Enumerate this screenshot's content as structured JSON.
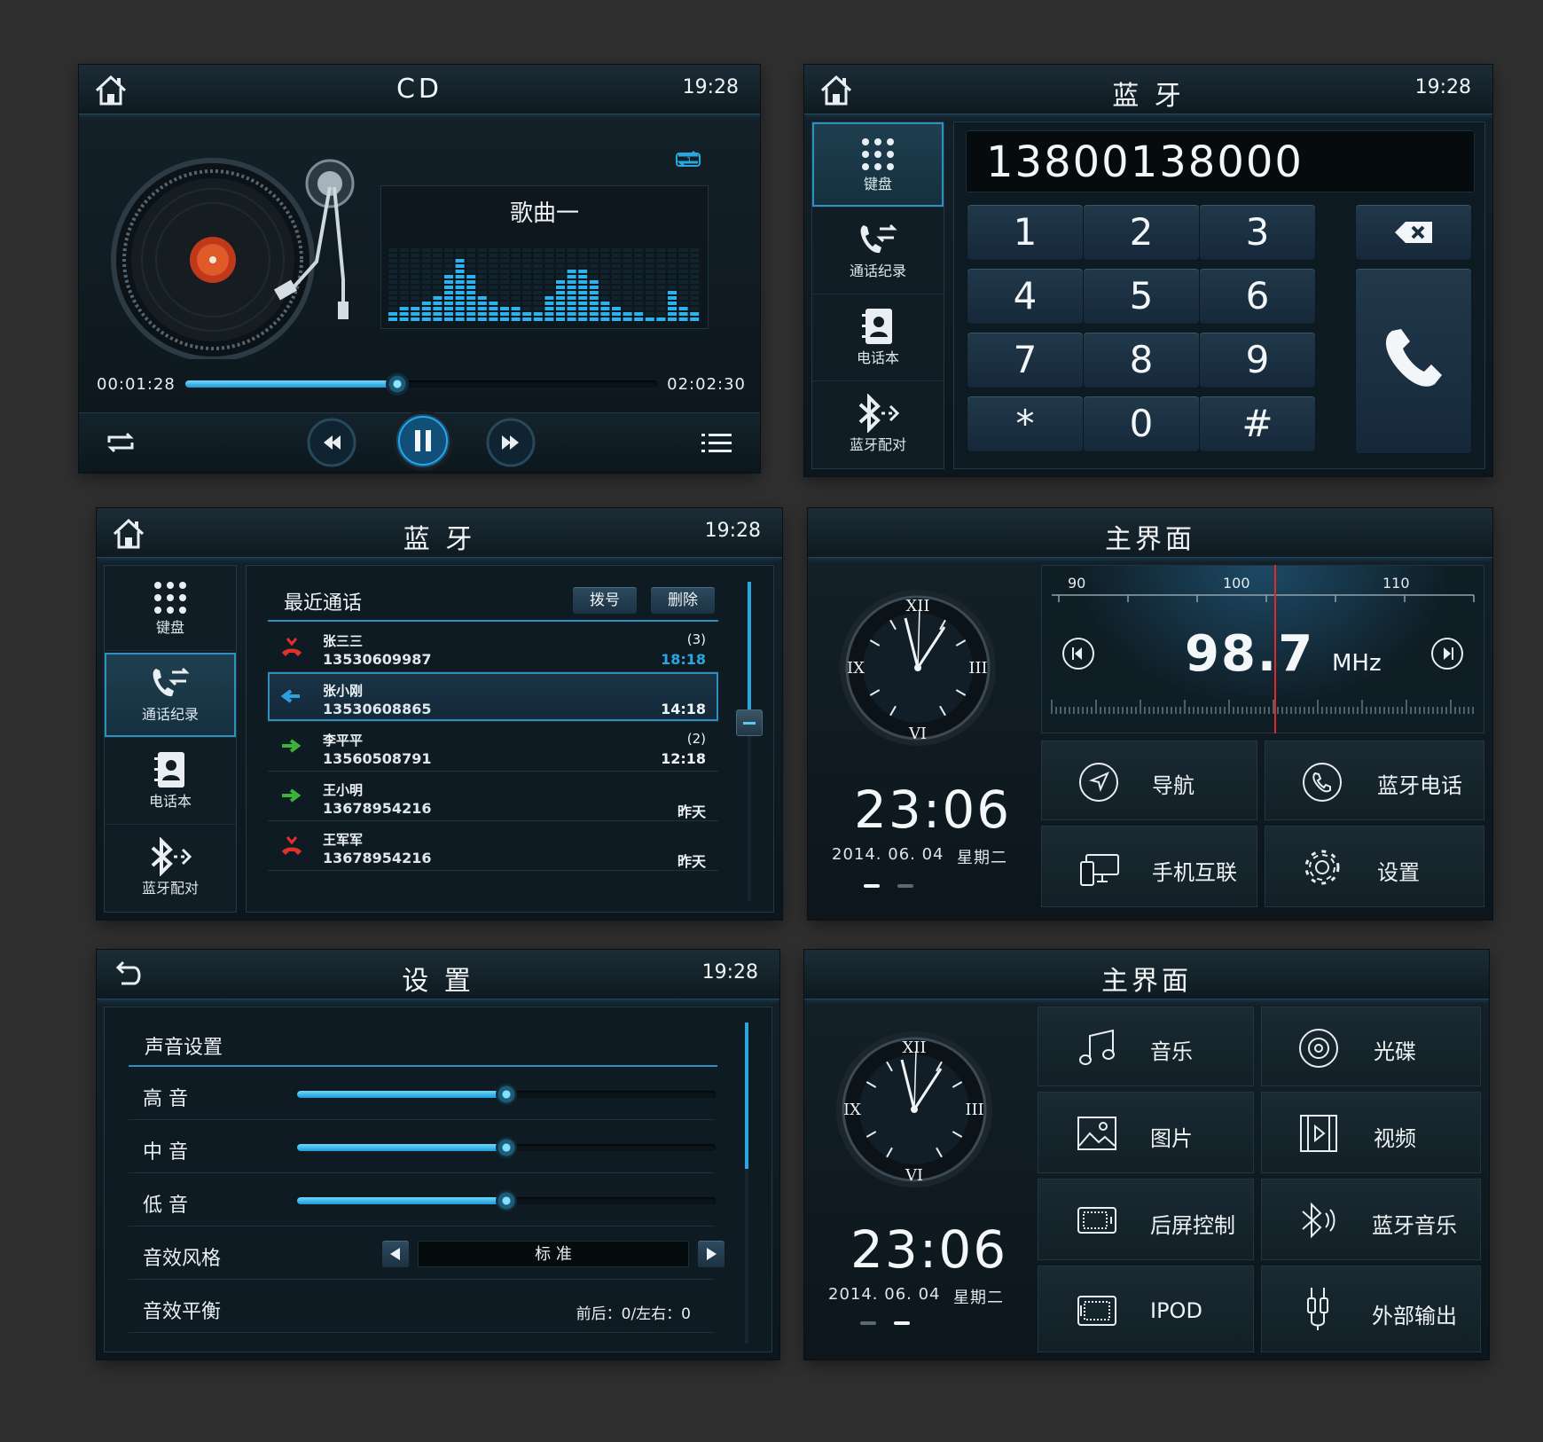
{
  "cd": {
    "title": "CD",
    "time": "19:28",
    "song": "歌曲一",
    "elapsed": "00:01:28",
    "total": "02:02:30",
    "progress": 0.45,
    "eq_levels": [
      2,
      3,
      3,
      4,
      5,
      9,
      12,
      9,
      5,
      4,
      3,
      3,
      2,
      2,
      5,
      8,
      10,
      10,
      8,
      4,
      3,
      2,
      2,
      1,
      1,
      6,
      3,
      2
    ]
  },
  "bt_dial": {
    "title": "蓝 牙",
    "time": "19:28",
    "number": "13800138000",
    "side": [
      "键盘",
      "通话纪录",
      "电话本",
      "蓝牙配对"
    ],
    "keys": [
      "1",
      "2",
      "3",
      "4",
      "5",
      "6",
      "7",
      "8",
      "9",
      "*",
      "0",
      "#"
    ]
  },
  "bt_log": {
    "title": "蓝 牙",
    "time": "19:28",
    "side": [
      "键盘",
      "通话纪录",
      "电话本",
      "蓝牙配对"
    ],
    "heading": "最近通话",
    "dial_btn": "拨号",
    "del_btn": "删除",
    "calls": [
      {
        "name": "张三三",
        "number": "13530609987",
        "count": "(3)",
        "time": "18:18",
        "type": "missed"
      },
      {
        "name": "张小刚",
        "number": "13530608865",
        "count": "",
        "time": "14:18",
        "type": "incoming"
      },
      {
        "name": "李平平",
        "number": "13560508791",
        "count": "(2)",
        "time": "12:18",
        "type": "outgoing"
      },
      {
        "name": "王小明",
        "number": "13678954216",
        "count": "",
        "time": "昨天",
        "type": "outgoing"
      },
      {
        "name": "王军军",
        "number": "13678954216",
        "count": "",
        "time": "昨天",
        "type": "missed"
      }
    ]
  },
  "home1": {
    "title": "主界面",
    "time": "23:06",
    "date": "2014. 06. 04",
    "weekday": "星期二",
    "freq_main": "98.7",
    "freq_unit": "MHz",
    "scale": [
      "90",
      "100",
      "110"
    ],
    "tiles": [
      "导航",
      "蓝牙电话",
      "手机互联",
      "设置"
    ]
  },
  "settings": {
    "title": "设 置",
    "time": "19:28",
    "section": "声音设置",
    "treble": "高 音",
    "mid": "中 音",
    "bass": "低 音",
    "treble_level": 0.5,
    "mid_level": 0.5,
    "bass_level": 0.5,
    "style_label": "音效风格",
    "style_value": "标 准",
    "balance_label": "音效平衡",
    "balance_value": "前后：0/左右：0"
  },
  "home2": {
    "title": "主界面",
    "time": "23:06",
    "date": "2014. 06. 04",
    "weekday": "星期二",
    "tiles": [
      "音乐",
      "光碟",
      "图片",
      "视频",
      "后屏控制",
      "蓝牙音乐",
      "IPOD",
      "外部输出"
    ]
  },
  "clock_numerals": [
    "XII",
    "III",
    "VI",
    "IX"
  ],
  "colors": {
    "accent": "#2aa6e0",
    "missed": "#e0312d",
    "incoming": "#2ea0e0",
    "outgoing": "#3fb23a"
  }
}
